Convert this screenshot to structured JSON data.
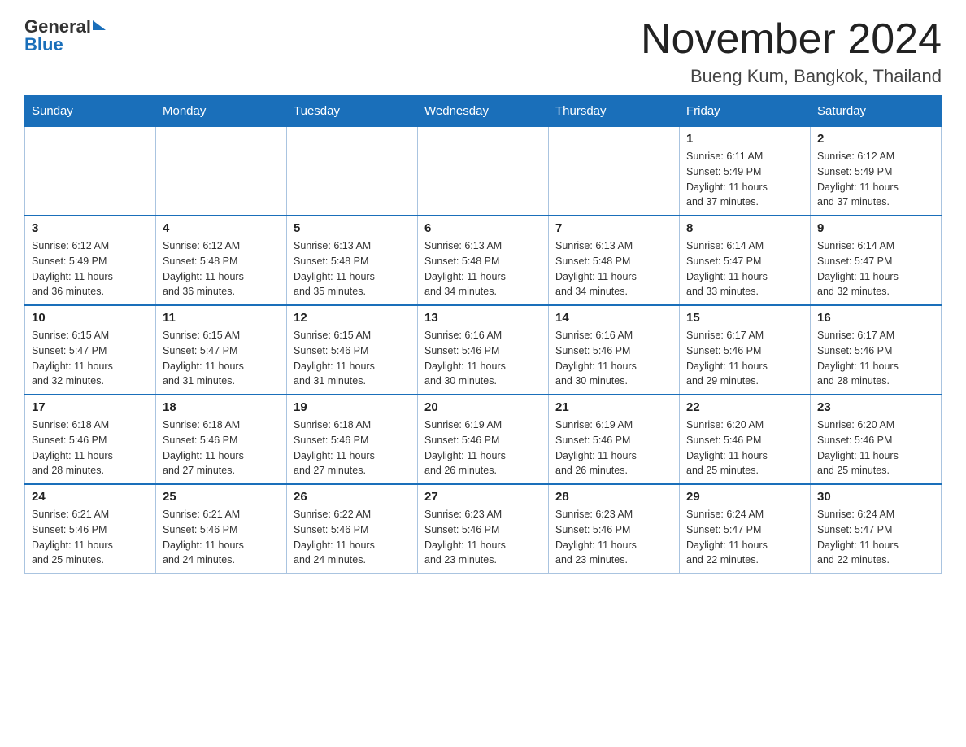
{
  "header": {
    "logo_general": "General",
    "logo_blue": "Blue",
    "month_title": "November 2024",
    "location": "Bueng Kum, Bangkok, Thailand"
  },
  "weekdays": [
    "Sunday",
    "Monday",
    "Tuesday",
    "Wednesday",
    "Thursday",
    "Friday",
    "Saturday"
  ],
  "weeks": [
    {
      "days": [
        {
          "num": "",
          "info": ""
        },
        {
          "num": "",
          "info": ""
        },
        {
          "num": "",
          "info": ""
        },
        {
          "num": "",
          "info": ""
        },
        {
          "num": "",
          "info": ""
        },
        {
          "num": "1",
          "info": "Sunrise: 6:11 AM\nSunset: 5:49 PM\nDaylight: 11 hours\nand 37 minutes."
        },
        {
          "num": "2",
          "info": "Sunrise: 6:12 AM\nSunset: 5:49 PM\nDaylight: 11 hours\nand 37 minutes."
        }
      ]
    },
    {
      "days": [
        {
          "num": "3",
          "info": "Sunrise: 6:12 AM\nSunset: 5:49 PM\nDaylight: 11 hours\nand 36 minutes."
        },
        {
          "num": "4",
          "info": "Sunrise: 6:12 AM\nSunset: 5:48 PM\nDaylight: 11 hours\nand 36 minutes."
        },
        {
          "num": "5",
          "info": "Sunrise: 6:13 AM\nSunset: 5:48 PM\nDaylight: 11 hours\nand 35 minutes."
        },
        {
          "num": "6",
          "info": "Sunrise: 6:13 AM\nSunset: 5:48 PM\nDaylight: 11 hours\nand 34 minutes."
        },
        {
          "num": "7",
          "info": "Sunrise: 6:13 AM\nSunset: 5:48 PM\nDaylight: 11 hours\nand 34 minutes."
        },
        {
          "num": "8",
          "info": "Sunrise: 6:14 AM\nSunset: 5:47 PM\nDaylight: 11 hours\nand 33 minutes."
        },
        {
          "num": "9",
          "info": "Sunrise: 6:14 AM\nSunset: 5:47 PM\nDaylight: 11 hours\nand 32 minutes."
        }
      ]
    },
    {
      "days": [
        {
          "num": "10",
          "info": "Sunrise: 6:15 AM\nSunset: 5:47 PM\nDaylight: 11 hours\nand 32 minutes."
        },
        {
          "num": "11",
          "info": "Sunrise: 6:15 AM\nSunset: 5:47 PM\nDaylight: 11 hours\nand 31 minutes."
        },
        {
          "num": "12",
          "info": "Sunrise: 6:15 AM\nSunset: 5:46 PM\nDaylight: 11 hours\nand 31 minutes."
        },
        {
          "num": "13",
          "info": "Sunrise: 6:16 AM\nSunset: 5:46 PM\nDaylight: 11 hours\nand 30 minutes."
        },
        {
          "num": "14",
          "info": "Sunrise: 6:16 AM\nSunset: 5:46 PM\nDaylight: 11 hours\nand 30 minutes."
        },
        {
          "num": "15",
          "info": "Sunrise: 6:17 AM\nSunset: 5:46 PM\nDaylight: 11 hours\nand 29 minutes."
        },
        {
          "num": "16",
          "info": "Sunrise: 6:17 AM\nSunset: 5:46 PM\nDaylight: 11 hours\nand 28 minutes."
        }
      ]
    },
    {
      "days": [
        {
          "num": "17",
          "info": "Sunrise: 6:18 AM\nSunset: 5:46 PM\nDaylight: 11 hours\nand 28 minutes."
        },
        {
          "num": "18",
          "info": "Sunrise: 6:18 AM\nSunset: 5:46 PM\nDaylight: 11 hours\nand 27 minutes."
        },
        {
          "num": "19",
          "info": "Sunrise: 6:18 AM\nSunset: 5:46 PM\nDaylight: 11 hours\nand 27 minutes."
        },
        {
          "num": "20",
          "info": "Sunrise: 6:19 AM\nSunset: 5:46 PM\nDaylight: 11 hours\nand 26 minutes."
        },
        {
          "num": "21",
          "info": "Sunrise: 6:19 AM\nSunset: 5:46 PM\nDaylight: 11 hours\nand 26 minutes."
        },
        {
          "num": "22",
          "info": "Sunrise: 6:20 AM\nSunset: 5:46 PM\nDaylight: 11 hours\nand 25 minutes."
        },
        {
          "num": "23",
          "info": "Sunrise: 6:20 AM\nSunset: 5:46 PM\nDaylight: 11 hours\nand 25 minutes."
        }
      ]
    },
    {
      "days": [
        {
          "num": "24",
          "info": "Sunrise: 6:21 AM\nSunset: 5:46 PM\nDaylight: 11 hours\nand 25 minutes."
        },
        {
          "num": "25",
          "info": "Sunrise: 6:21 AM\nSunset: 5:46 PM\nDaylight: 11 hours\nand 24 minutes."
        },
        {
          "num": "26",
          "info": "Sunrise: 6:22 AM\nSunset: 5:46 PM\nDaylight: 11 hours\nand 24 minutes."
        },
        {
          "num": "27",
          "info": "Sunrise: 6:23 AM\nSunset: 5:46 PM\nDaylight: 11 hours\nand 23 minutes."
        },
        {
          "num": "28",
          "info": "Sunrise: 6:23 AM\nSunset: 5:46 PM\nDaylight: 11 hours\nand 23 minutes."
        },
        {
          "num": "29",
          "info": "Sunrise: 6:24 AM\nSunset: 5:47 PM\nDaylight: 11 hours\nand 22 minutes."
        },
        {
          "num": "30",
          "info": "Sunrise: 6:24 AM\nSunset: 5:47 PM\nDaylight: 11 hours\nand 22 minutes."
        }
      ]
    }
  ]
}
